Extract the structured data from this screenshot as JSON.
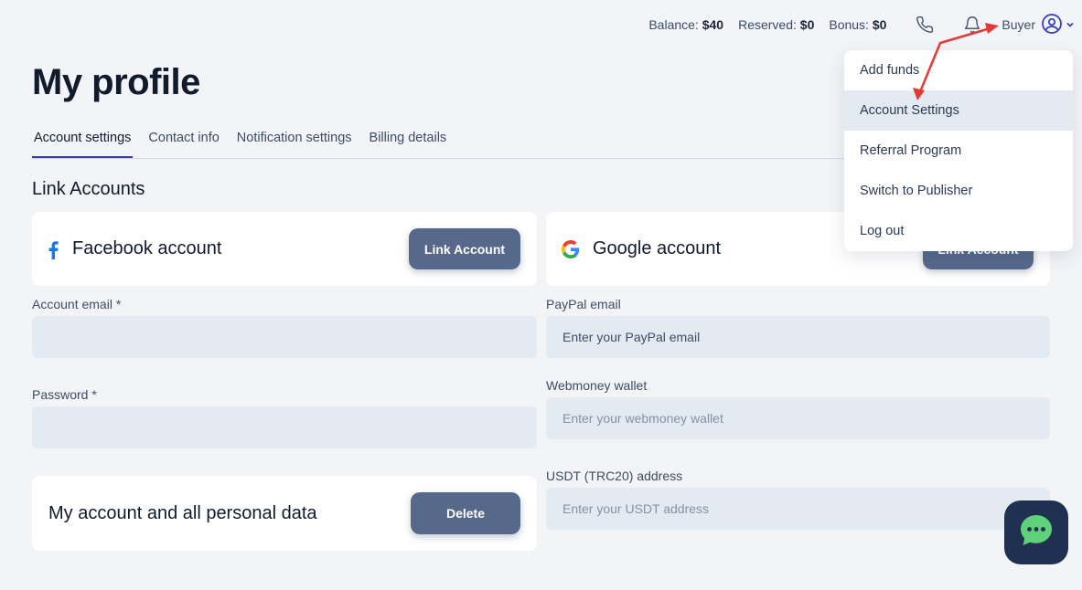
{
  "header": {
    "balance_label": "Balance:",
    "balance_value": "$40",
    "reserved_label": "Reserved:",
    "reserved_value": "$0",
    "bonus_label": "Bonus:",
    "bonus_value": "$0",
    "user_name": "Buyer",
    "icons": [
      "phone-icon",
      "bell-icon",
      "user-circle-icon",
      "chevron-down-icon"
    ]
  },
  "page_title": "My profile",
  "tabs": [
    {
      "label": "Account settings",
      "active": true
    },
    {
      "label": "Contact info"
    },
    {
      "label": "Notification settings"
    },
    {
      "label": "Billing details"
    }
  ],
  "link_accounts": {
    "section_title": "Link Accounts",
    "facebook": {
      "label": "Facebook account",
      "button": "Link Account"
    },
    "google": {
      "label": "Google account",
      "button": "Link Account"
    }
  },
  "form": {
    "account_email_label": "Account email *",
    "account_email_value": "",
    "password_label": "Password *",
    "password_value": "",
    "paypal_label": "PayPal email",
    "paypal_placeholder": "Enter your PayPal email",
    "webmoney_label": "Webmoney wallet",
    "webmoney_placeholder": "Enter your webmoney wallet",
    "usdt_label": "USDT (TRC20) address",
    "usdt_placeholder": "Enter your USDT address"
  },
  "delete_card": {
    "label": "My account and all personal data",
    "button": "Delete"
  },
  "dropdown": {
    "items": [
      {
        "label": "Add funds"
      },
      {
        "label": "Account Settings",
        "active": true
      },
      {
        "label": "Referral Program"
      },
      {
        "label": "Switch to Publisher"
      },
      {
        "label": "Log out"
      }
    ]
  },
  "colors": {
    "background": "#f2f4f8",
    "button": "#56698a",
    "tab_underline": "#2c3ab8",
    "annotation_arrow": "#e53935",
    "chat_bubble": "#1f3050",
    "chat_icon": "#5fd17b"
  }
}
